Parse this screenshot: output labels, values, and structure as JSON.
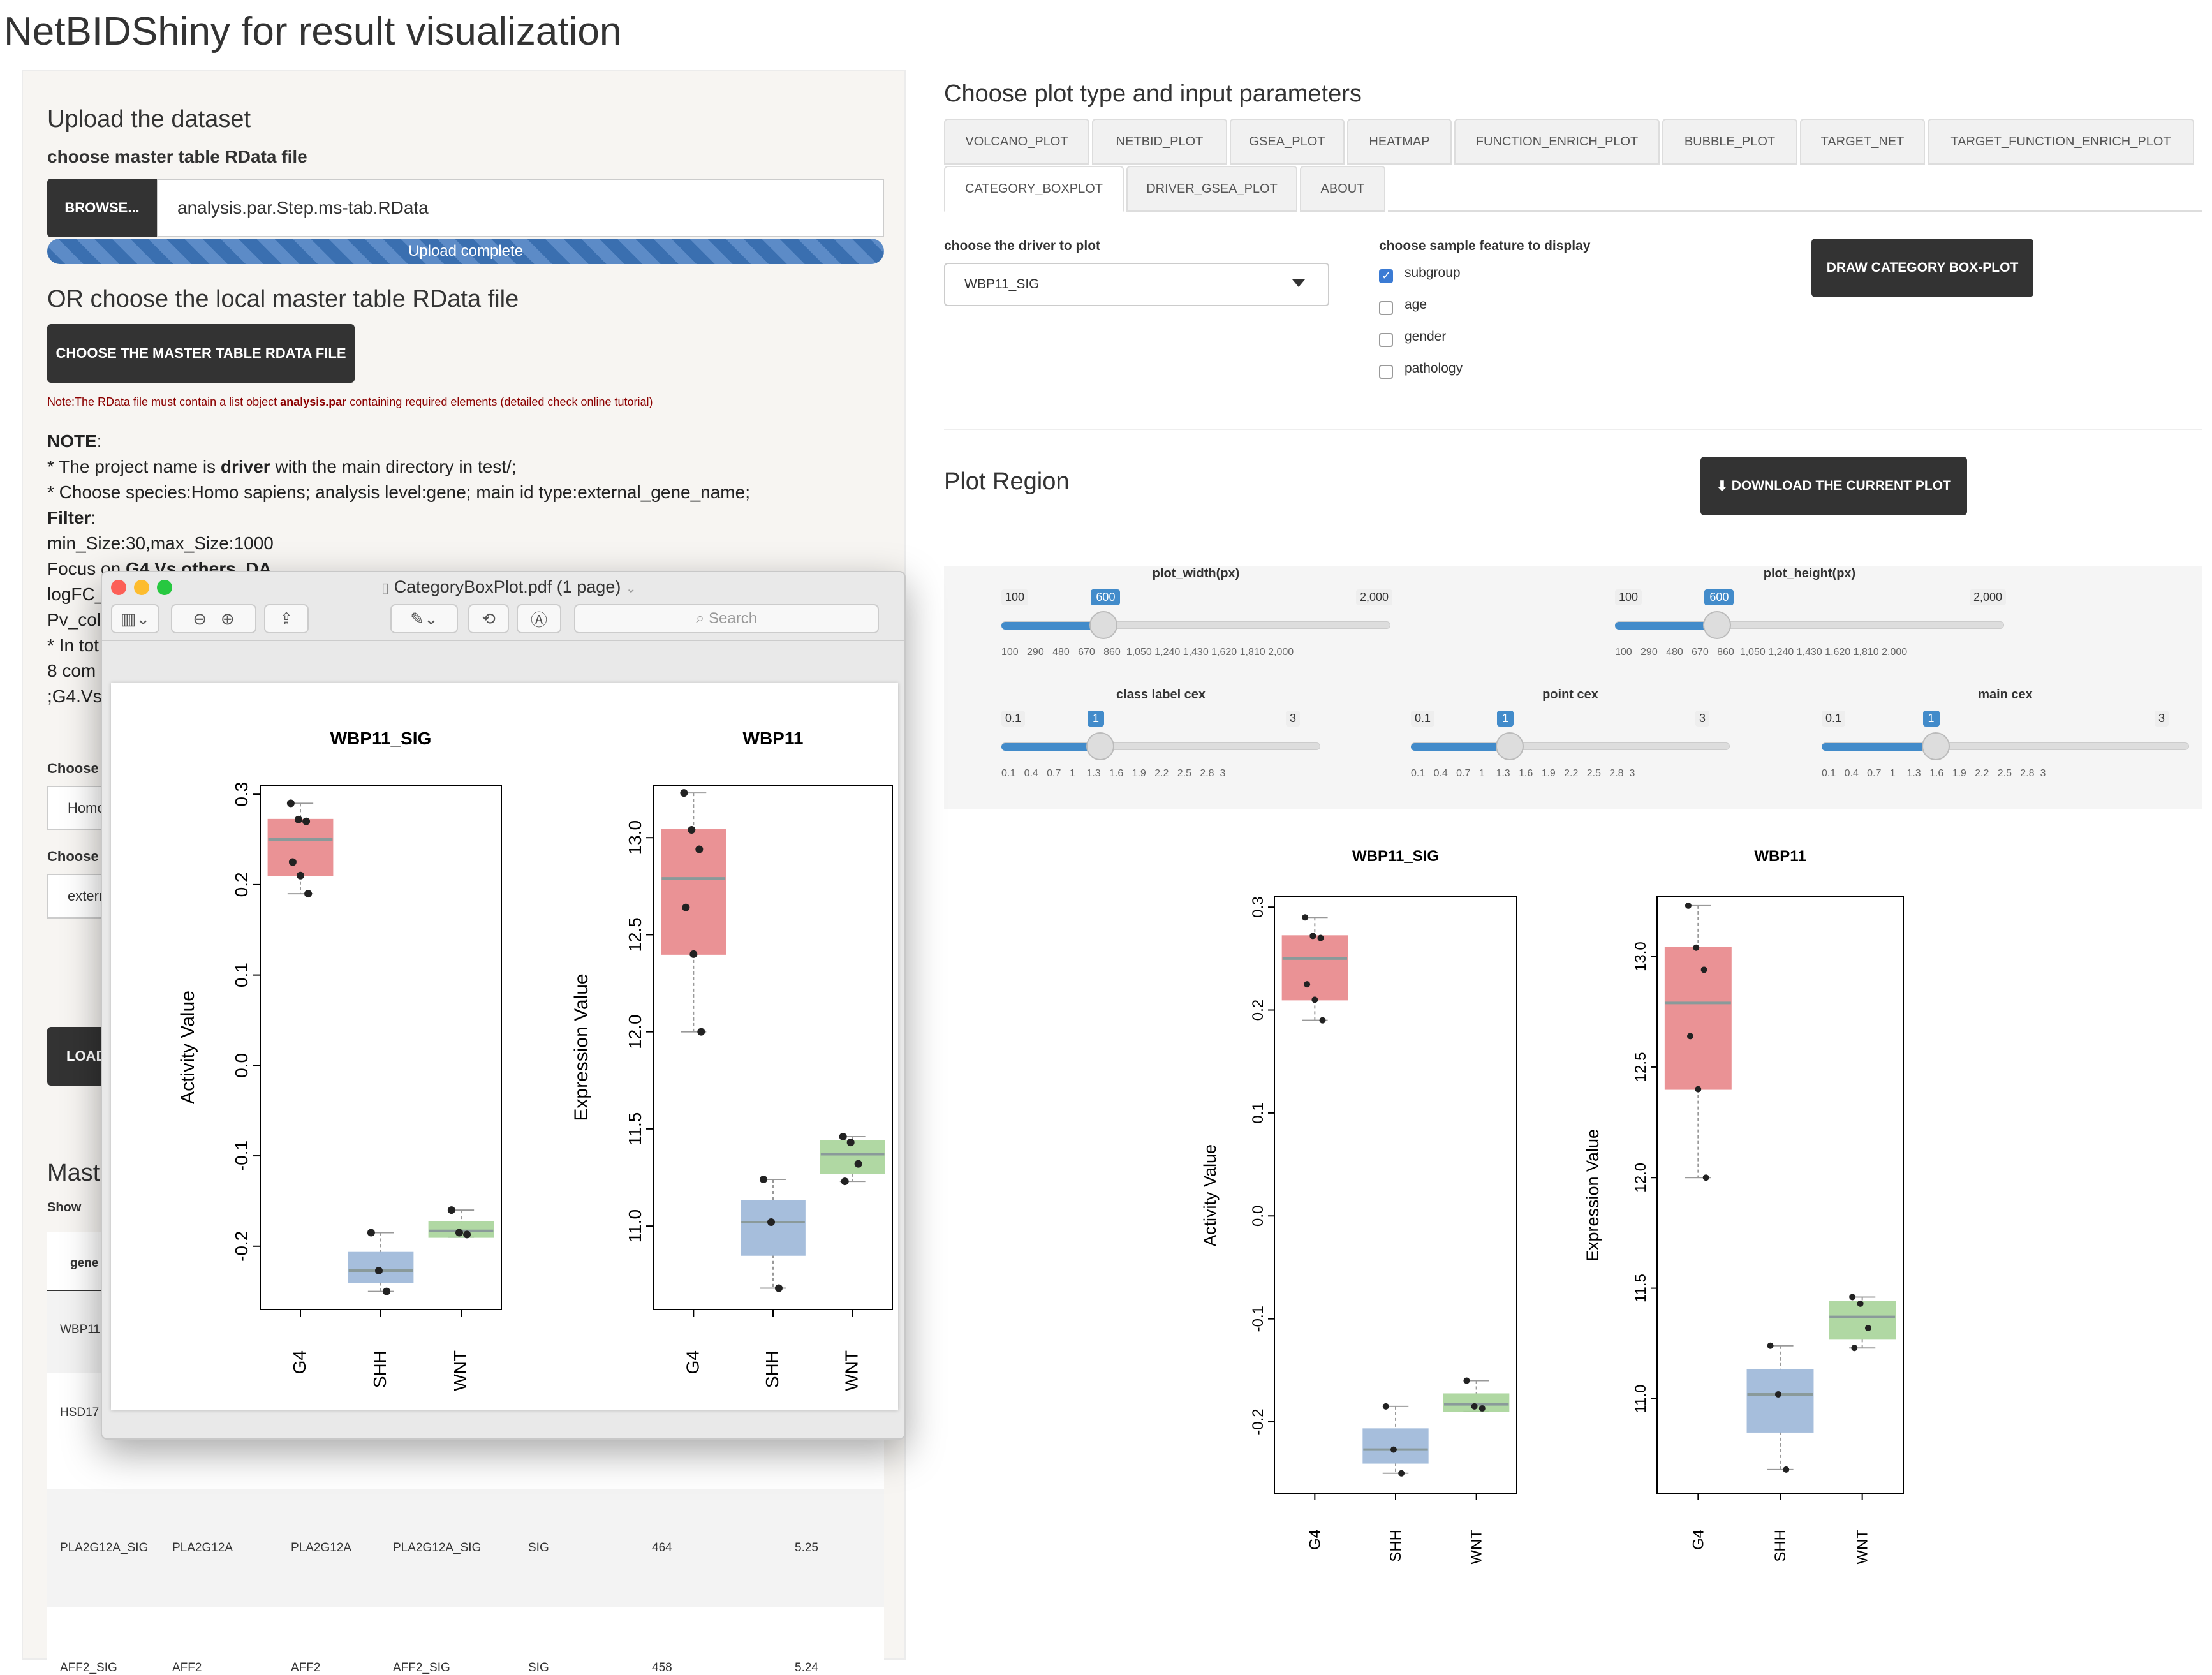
{
  "app_title": "NetBIDShiny for result visualization",
  "upload": {
    "heading": "Upload the dataset",
    "file_label": "choose master table RData file",
    "browse_label": "BROWSE...",
    "file_value": "analysis.par.Step.ms-tab.RData",
    "progress_text": "Upload complete",
    "progress": 1.0,
    "or_heading": "OR choose the local master table RData file",
    "choose_button": "CHOOSE THE MASTER TABLE RDATA FILE",
    "note_red_1": "Note:The RData file must contain a list object ",
    "note_red_bold": "analysis.par",
    "note_red_2": " containing required elements (detailed check online tutorial)"
  },
  "note": {
    "title": "NOTE",
    "line1_pre": "* The project name is ",
    "line1_bold": "driver",
    "line1_post": " with the main directory in test/;",
    "line2": "* Choose species:Homo sapiens; analysis level:gene; main id type:external_gene_name;",
    "filter_label": "Filter",
    "line4": "min_Size:30,max_Size:1000",
    "line5_pre": "Focus on ",
    "line5_bold": "G4.Vs.others_DA",
    "line6": "logFC_",
    "line7": "Pv_col",
    "line8": "* In tot",
    "line9": "8 com",
    "line10": ";G4.Vs"
  },
  "left_partial": {
    "choose1": "Choose",
    "select1": "Homo",
    "choose2": "Choose",
    "select2": "extern",
    "load_btn": "LOAD",
    "master_heading": "Mast",
    "show_label": "Show",
    "col_gene": "gene"
  },
  "table_rows": [
    [
      "WBP11",
      "",
      "",
      "",
      "",
      "",
      ""
    ],
    [
      "HSD17",
      "",
      "",
      "",
      "",
      "",
      ""
    ],
    [
      "PLA2G12A_SIG",
      "PLA2G12A",
      "PLA2G12A",
      "PLA2G12A_SIG",
      "SIG",
      "464",
      "5.25"
    ],
    [
      "AFF2_SIG",
      "AFF2",
      "AFF2",
      "AFF2_SIG",
      "SIG",
      "458",
      "5.24"
    ]
  ],
  "right": {
    "heading": "Choose plot type and input parameters",
    "tabs_row1": [
      "VOLCANO_PLOT",
      "NETBID_PLOT",
      "GSEA_PLOT",
      "HEATMAP",
      "FUNCTION_ENRICH_PLOT",
      "BUBBLE_PLOT",
      "TARGET_NET",
      "TARGET_FUNCTION_ENRICH_PLOT"
    ],
    "tabs_row2": [
      "CATEGORY_BOXPLOT",
      "DRIVER_GSEA_PLOT",
      "ABOUT"
    ],
    "driver_label": "choose the driver to plot",
    "driver_value": "WBP11_SIG",
    "feature_label": "choose sample feature to display",
    "features": [
      {
        "label": "subgroup",
        "checked": true
      },
      {
        "label": "age",
        "checked": false
      },
      {
        "label": "gender",
        "checked": false
      },
      {
        "label": "pathology",
        "checked": false
      }
    ],
    "draw_button": "DRAW CATEGORY BOX-PLOT",
    "plot_region": "Plot Region",
    "download_button": "DOWNLOAD THE CURRENT PLOT"
  },
  "sliders": [
    {
      "label": "plot_width(px)",
      "min": "100",
      "max": "2,000",
      "value": "600",
      "fraction": 0.263,
      "ticks": "100   290   480   670   860  1,050 1,240 1,430 1,620 1,810 2,000"
    },
    {
      "label": "plot_height(px)",
      "min": "100",
      "max": "2,000",
      "value": "600",
      "fraction": 0.263,
      "ticks": "100   290   480   670   860  1,050 1,240 1,430 1,620 1,810 2,000"
    },
    {
      "label": "class label cex",
      "min": "0.1",
      "max": "3",
      "value": "1",
      "fraction": 0.31,
      "ticks": "0.1   0.4   0.7   1    1.3   1.6   1.9   2.2   2.5   2.8  3"
    },
    {
      "label": "point cex",
      "min": "0.1",
      "max": "3",
      "value": "1",
      "fraction": 0.31,
      "ticks": "0.1   0.4   0.7   1    1.3   1.6   1.9   2.2   2.5   2.8  3"
    },
    {
      "label": "main cex",
      "min": "0.1",
      "max": "3",
      "value": "1",
      "fraction": 0.31,
      "ticks": "0.1   0.4   0.7   1    1.3   1.6   1.9   2.2   2.5   2.8  3"
    }
  ],
  "pdf_window": {
    "title": "CategoryBoxPlot.pdf (1 page)",
    "search_placeholder": "Search"
  },
  "chart_data": [
    {
      "type": "box",
      "title": "WBP11_SIG",
      "ylabel": "Activity Value",
      "categories": [
        "G4",
        "SHH",
        "WNT"
      ],
      "colors": [
        "#e8878a",
        "#9db8d9",
        "#a8d49a"
      ],
      "yticks": [
        -0.2,
        -0.1,
        0.0,
        0.1,
        0.2,
        0.3
      ],
      "ylim": [
        -0.27,
        0.31
      ],
      "boxes": [
        {
          "q1": 0.21,
          "median": 0.25,
          "q3": 0.272,
          "min": 0.19,
          "max": 0.29,
          "points": [
            0.29,
            0.272,
            0.27,
            0.225,
            0.21,
            0.19
          ]
        },
        {
          "q1": -0.24,
          "median": -0.227,
          "q3": -0.207,
          "min": -0.25,
          "max": -0.185,
          "points": [
            -0.185,
            -0.227,
            -0.25
          ]
        },
        {
          "q1": -0.19,
          "median": -0.183,
          "q3": -0.173,
          "min": -0.19,
          "max": -0.16,
          "points": [
            -0.16,
            -0.185,
            -0.187
          ]
        }
      ]
    },
    {
      "type": "box",
      "title": "WBP11",
      "ylabel": "Expression Value",
      "categories": [
        "G4",
        "SHH",
        "WNT"
      ],
      "colors": [
        "#e8878a",
        "#9db8d9",
        "#a8d49a"
      ],
      "yticks": [
        11.0,
        11.5,
        12.0,
        12.5,
        13.0
      ],
      "ylim": [
        10.57,
        13.27
      ],
      "boxes": [
        {
          "q1": 12.4,
          "median": 12.79,
          "q3": 13.04,
          "min": 12.0,
          "max": 13.23,
          "points": [
            13.23,
            13.04,
            12.94,
            12.64,
            12.4,
            12.0
          ]
        },
        {
          "q1": 10.85,
          "median": 11.02,
          "q3": 11.13,
          "min": 10.68,
          "max": 11.24,
          "points": [
            11.24,
            11.02,
            10.68
          ]
        },
        {
          "q1": 11.27,
          "median": 11.37,
          "q3": 11.44,
          "min": 11.23,
          "max": 11.46,
          "points": [
            11.46,
            11.43,
            11.32,
            11.23
          ]
        }
      ]
    }
  ]
}
